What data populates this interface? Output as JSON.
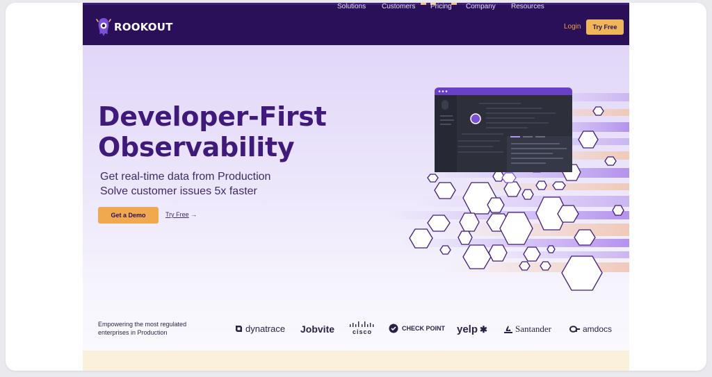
{
  "nav": {
    "logo_text": "ROOKOUT",
    "items": [
      "Solutions",
      "Customers",
      "Pricing",
      "Company",
      "Resources"
    ],
    "login": "Login",
    "try_free": "Try Free"
  },
  "hero": {
    "title_line1": "Developer-First",
    "title_line2": "Observability",
    "subtitle_line1": "Get real-time data from Production",
    "subtitle_line2": "Solve customer issues 5x faster",
    "demo_button": "Get a Demo",
    "try_link": "Try Free",
    "try_arrow": "→"
  },
  "customers": {
    "caption_line1": "Empowering the most regulated",
    "caption_line2": "enterprises in Production",
    "logos": [
      "dynatrace",
      "Jobvite",
      "cisco",
      "CHECK POINT",
      "yelp",
      "Santander",
      "amdocs"
    ]
  },
  "colors": {
    "nav_bg": "#2a0f59",
    "accent": "#f0b45a",
    "title": "#3f1a7a"
  }
}
